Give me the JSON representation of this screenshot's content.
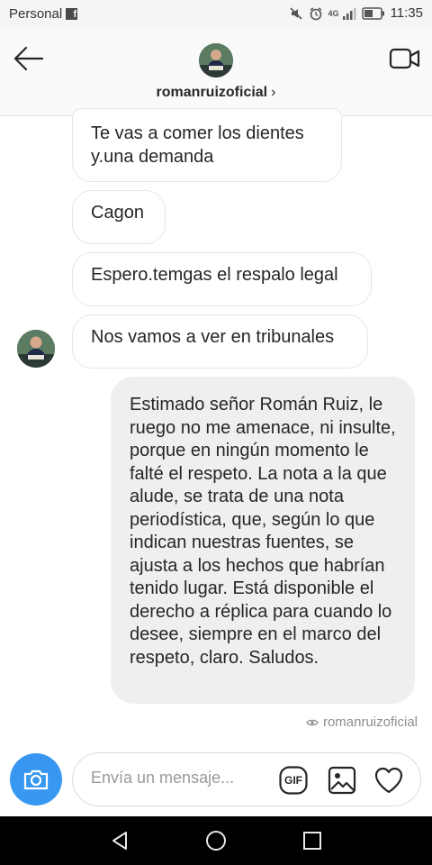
{
  "status_bar": {
    "carrier": "Personal",
    "network": "4G",
    "time": "11:35"
  },
  "header": {
    "username": "romanruizoficial",
    "chevron": "›"
  },
  "messages": {
    "incoming": [
      "Te vas a comer los dientes y.una demanda",
      "Cagon",
      "Espero.temgas el respalo legal",
      "Nos vamos a ver en tribunales"
    ],
    "outgoing": "Estimado señor Román Ruiz, le ruego no me amenace, ni insulte, porque en ningún momento le falté el respeto. La nota a la que alude, se trata de una nota periodística, que, según lo que indican nuestras fuentes, se ajusta a los hechos que habrían tenido lugar. Está disponible el derecho a réplica para cuando lo desee, siempre en el marco del respeto, claro. Saludos.",
    "seen_by": "romanruizoficial"
  },
  "composer": {
    "placeholder": "Envía un mensaje...",
    "gif_label": "GIF"
  },
  "icons": {
    "back": "arrow-left-icon",
    "video": "video-camera-icon",
    "camera": "camera-icon",
    "gif": "gif-icon",
    "gallery": "image-icon",
    "heart": "heart-icon",
    "seen": "eye-icon",
    "nav_back": "triangle-back-icon",
    "nav_home": "circle-home-icon",
    "nav_recents": "square-recents-icon"
  },
  "colors": {
    "accent": "#3897f0",
    "outgoing_bubble": "#efefef",
    "incoming_border": "#e6e6e6",
    "nav_bar": "#000000"
  }
}
